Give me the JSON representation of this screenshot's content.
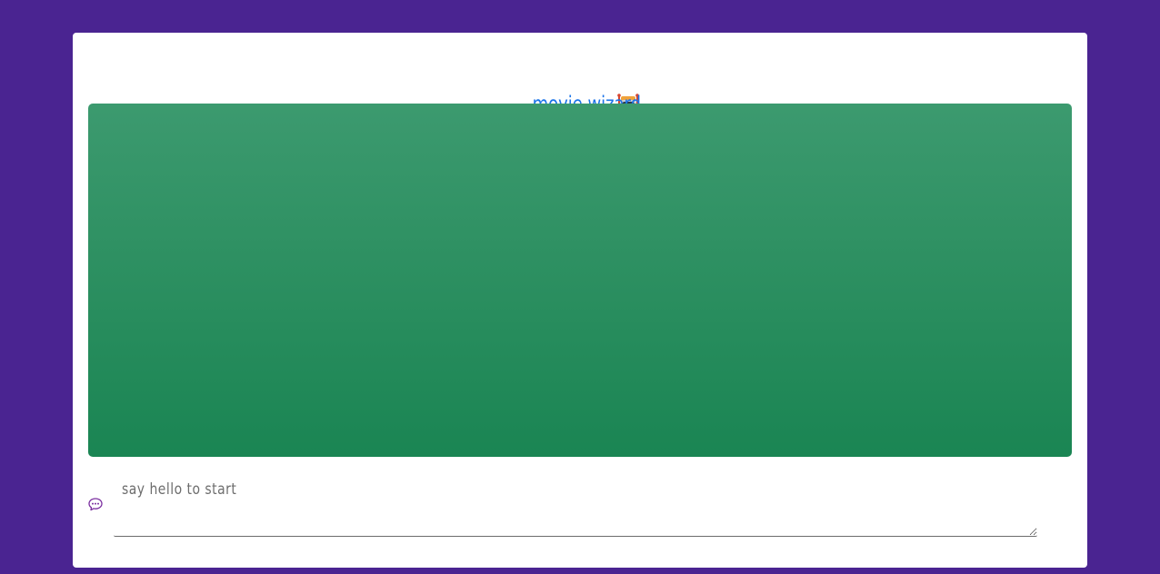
{
  "app": {
    "title": "movie wizard",
    "title_icon": "robot-icon",
    "status_indicator": "status-dot"
  },
  "chat_panel": {
    "gradient_top": "#3c9a6f",
    "gradient_bottom": "#1a8553"
  },
  "input": {
    "icon": "chat-bubble-icon",
    "placeholder": "say hello to start",
    "value": ""
  },
  "colors": {
    "page_background": "#4a2491",
    "title": "#1a73e8",
    "card": "#ffffff"
  }
}
